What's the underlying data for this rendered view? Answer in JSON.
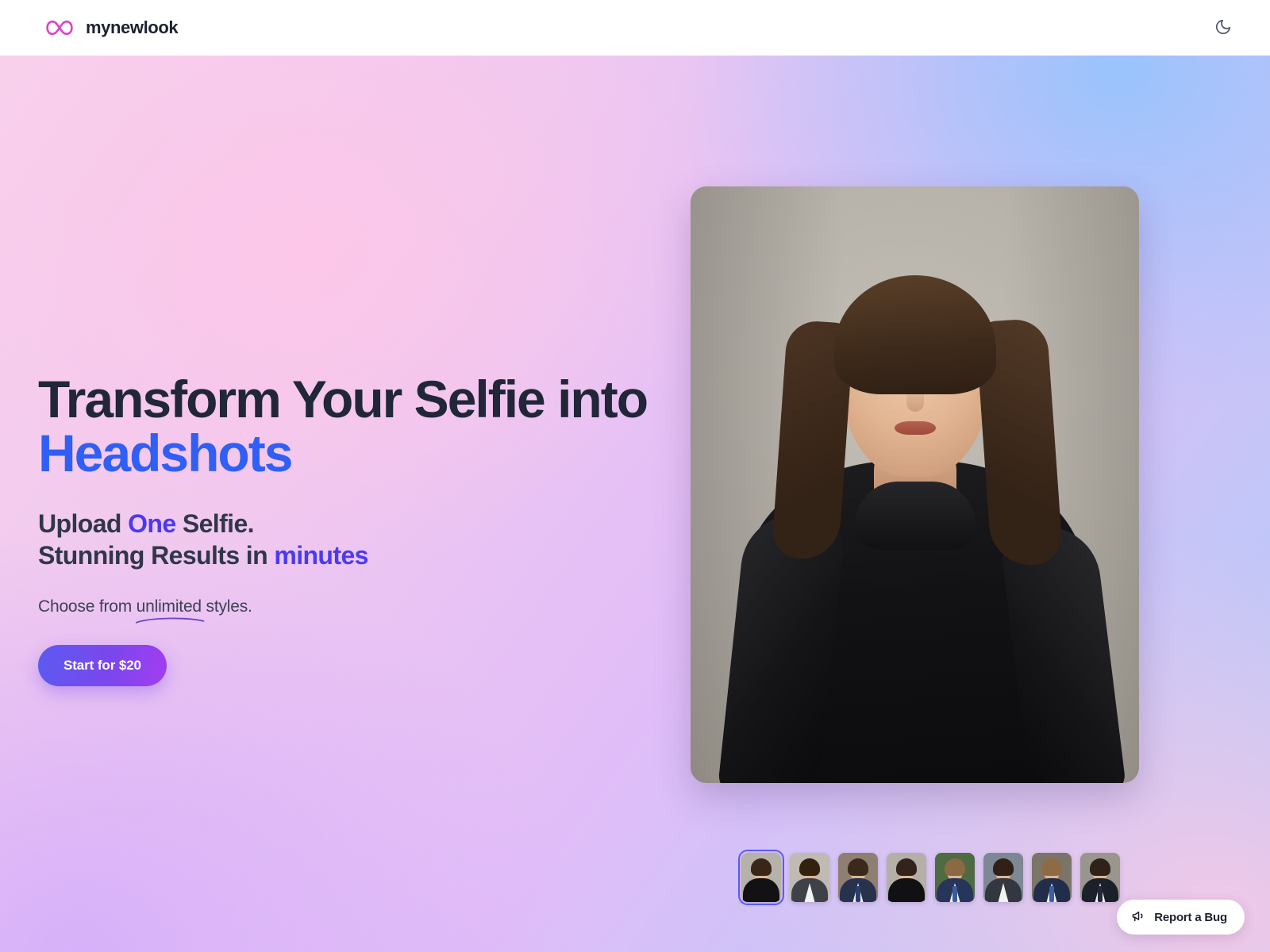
{
  "header": {
    "brand_name": "mynewlook",
    "logo_icon": "infinity-icon",
    "logo_color": "#d946c8",
    "theme_toggle_icon": "moon-icon"
  },
  "hero": {
    "headline_line1": "Transform Your Selfie into",
    "headline_line2": "Headshots",
    "headline_color": "#212738",
    "headline_accent_color": "#2f5ff5",
    "subhead_1a": "Upload ",
    "subhead_1b": "One",
    "subhead_1c": " Selfie.",
    "subhead_2a": "Stunning Results in ",
    "subhead_2b": "minutes",
    "subhead_accent_color": "#4a3af0",
    "tagline_a": "Choose from ",
    "tagline_b": "unlimited",
    "tagline_c": " styles.",
    "cta_label": "Start for $20",
    "cta_gradient_from": "#5b5bf0",
    "cta_gradient_to": "#a23df0",
    "background_colors": {
      "top_left": "#f8d1ec",
      "top_right": "#a4c9f7",
      "bottom_left": "#d9b7f8",
      "bottom_right": "#f6c8e7"
    }
  },
  "preview": {
    "alt": "AI generated headshot of woman in black turtleneck on grey studio background",
    "backdrop_color": "#b3aea6"
  },
  "thumbnails": [
    {
      "label": "Woman black turtleneck studio",
      "selected": true,
      "bg": "#b6b1a9",
      "hair": "#3a2618",
      "long_hair": true,
      "outfit": "#121214",
      "shirt": false,
      "tie": null
    },
    {
      "label": "Woman grey blazer studio",
      "selected": false,
      "bg": "#bfbab2",
      "hair": "#33210f",
      "long_hair": true,
      "outfit": "#3e4148",
      "shirt": true,
      "tie": null
    },
    {
      "label": "Man navy suit city street",
      "selected": false,
      "bg": "#8f7f72",
      "hair": "#3b2a1b",
      "long_hair": false,
      "outfit": "#28324d",
      "shirt": true,
      "tie": "#2a3f6b"
    },
    {
      "label": "Man black turtleneck studio",
      "selected": false,
      "bg": "#b4afa7",
      "hair": "#33231a",
      "long_hair": false,
      "outfit": "#111113",
      "shirt": false,
      "tie": null
    },
    {
      "label": "Man blue suit garden",
      "selected": false,
      "bg": "#4f6b42",
      "hair": "#8a6a42",
      "long_hair": false,
      "outfit": "#27355a",
      "shirt": true,
      "tie": "#3a5d9a"
    },
    {
      "label": "Woman suit city skyline",
      "selected": false,
      "bg": "#7e8794",
      "hair": "#2f2118",
      "long_hair": true,
      "outfit": "#33373f",
      "shirt": true,
      "tie": null
    },
    {
      "label": "Man navy suit office",
      "selected": false,
      "bg": "#7b7468",
      "hair": "#8d6c44",
      "long_hair": false,
      "outfit": "#222d4b",
      "shirt": true,
      "tie": "#3c5fa2"
    },
    {
      "label": "Man dark suit studio",
      "selected": false,
      "bg": "#9a958d",
      "hair": "#2f2219",
      "long_hair": false,
      "outfit": "#1c2029",
      "shirt": true,
      "tie": "#23283a"
    }
  ],
  "bug_report": {
    "label": "Report a Bug",
    "icon": "megaphone-icon"
  }
}
